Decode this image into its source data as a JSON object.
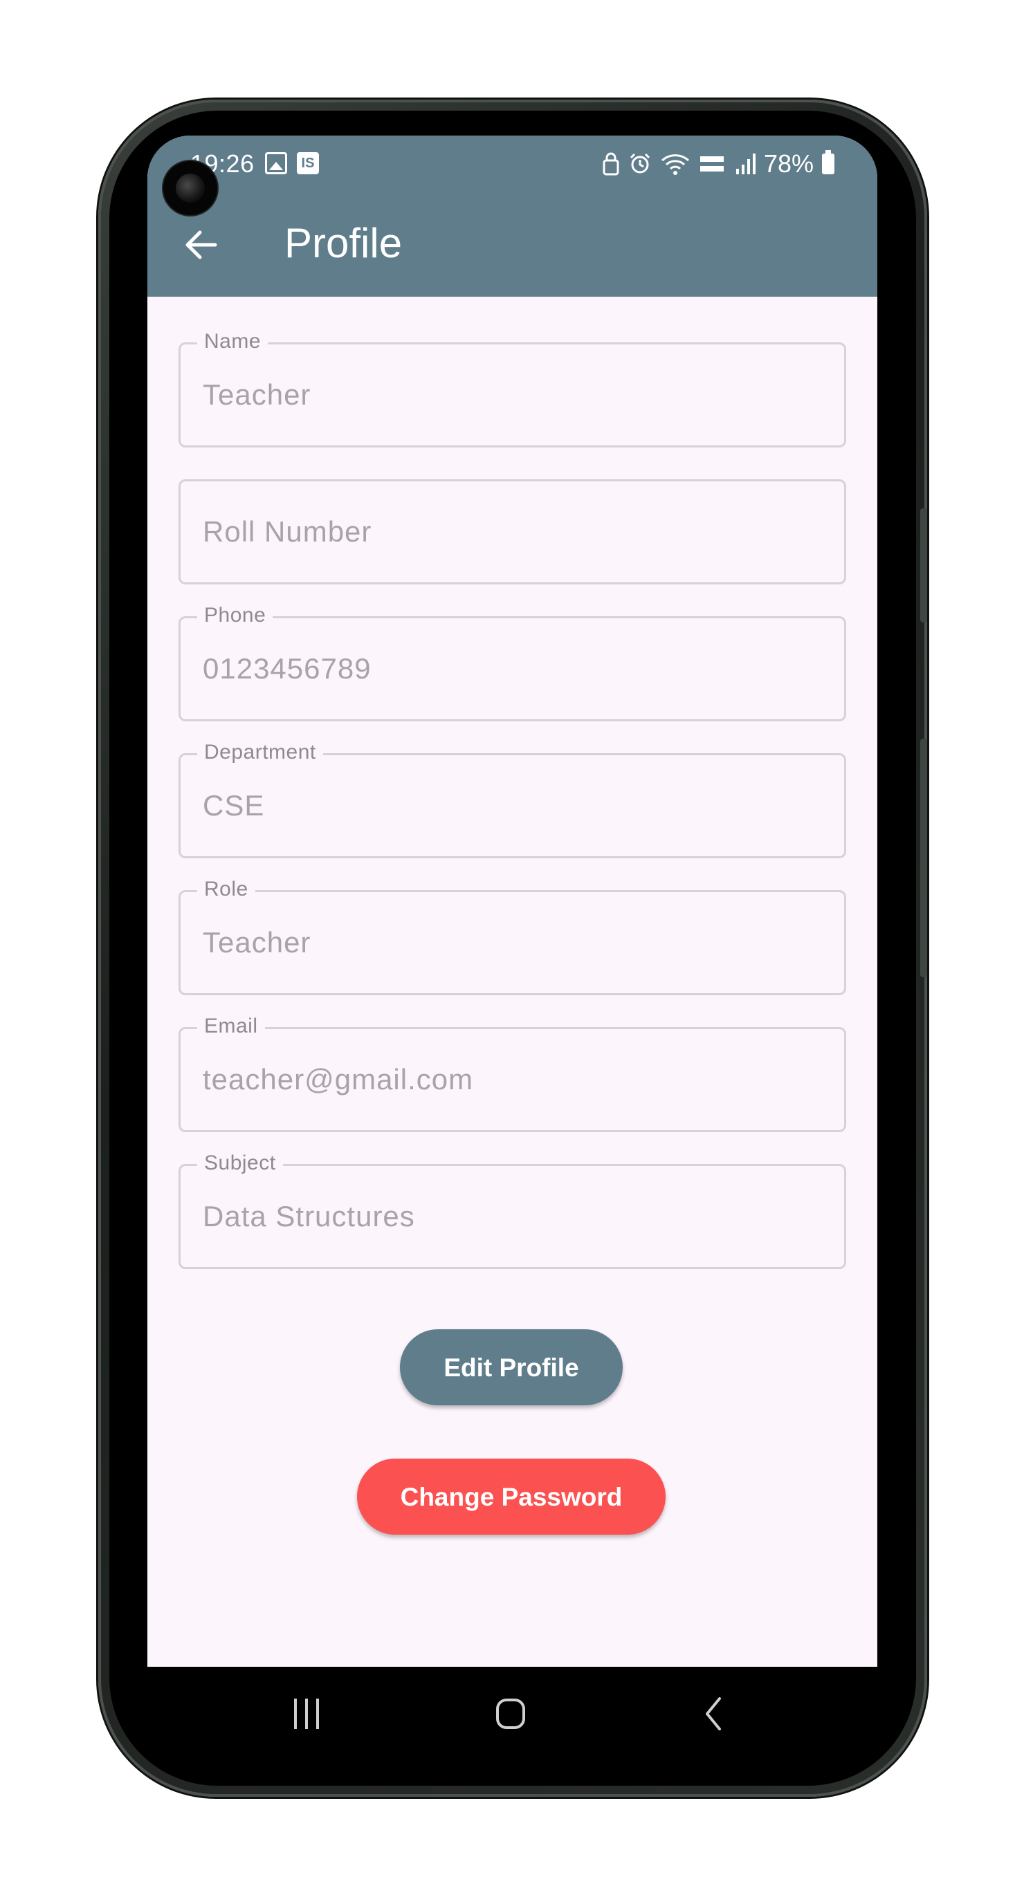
{
  "status_bar": {
    "time": "19:26",
    "is_badge": "IS",
    "battery": "78%"
  },
  "app_bar": {
    "title": "Profile"
  },
  "form": {
    "fields": [
      {
        "label": "Name",
        "value": "Teacher"
      },
      {
        "label": "",
        "value": "Roll Number"
      },
      {
        "label": "Phone",
        "value": "0123456789"
      },
      {
        "label": "Department",
        "value": "CSE"
      },
      {
        "label": "Role",
        "value": "Teacher"
      },
      {
        "label": "Email",
        "value": "teacher@gmail.com"
      },
      {
        "label": "Subject",
        "value": "Data Structures"
      }
    ]
  },
  "actions": {
    "edit_label": "Edit Profile",
    "change_password_label": "Change Password"
  },
  "colors": {
    "app_bar": "#607d8b",
    "background": "#fcf5fc",
    "edit_button": "#607d8b",
    "change_password_button": "#fb5151"
  },
  "icons": {
    "back": "arrow-left-icon",
    "nav_recents": "recents-icon",
    "nav_home": "home-icon",
    "nav_back": "chevron-left-icon"
  }
}
